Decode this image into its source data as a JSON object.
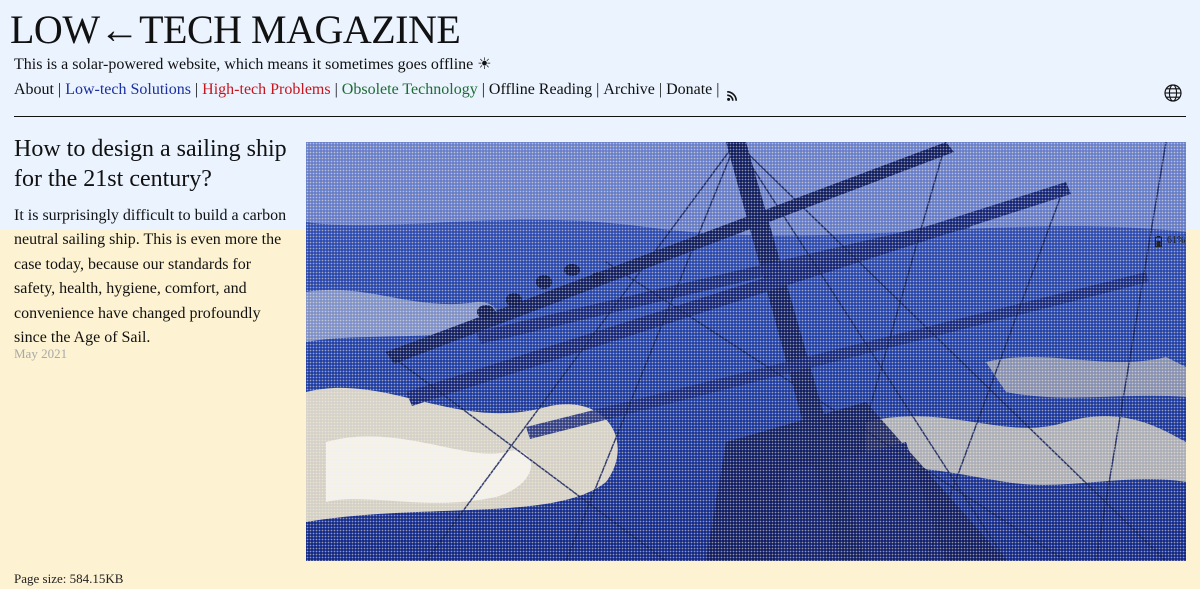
{
  "header": {
    "site_title": "LOW←TECH MAGAZINE",
    "tagline": "This is a solar-powered website, which means it sometimes goes offline ☀"
  },
  "nav": {
    "about": "About",
    "lowtech": "Low-tech Solutions",
    "hightech": "High-tech Problems",
    "obsolete": "Obsolete Technology",
    "offline": "Offline Reading",
    "archive": "Archive",
    "donate": "Donate",
    "separator": "|",
    "rss_icon": "rss-icon",
    "language_icon": "globe-icon"
  },
  "colors": {
    "background_top": "#eaf3fe",
    "background_bottom": "#fdf2d1",
    "lowtech": "#1a2fa0",
    "hightech": "#c4161c",
    "obsolete": "#1f6b35",
    "image_ink": "#1f3fa8",
    "date_gray": "#a8a8a8"
  },
  "article": {
    "title": "How to design a sailing ship for the 21st century?",
    "summary": "It is surprisingly difficult to build a carbon neutral sailing ship. This is even more the case today, because our standards for safety, health, hygiene, comfort, and convenience have changed profoundly since the Age of Sail.",
    "date": "May 2021",
    "image_subject": "dithered photo of a sailing ship's rigging and crew on yards over rough sea"
  },
  "battery": {
    "level_text": "61%",
    "level_fraction": 0.61,
    "icon": "battery-icon"
  },
  "footer": {
    "page_size": "Page size: 584.15KB"
  }
}
